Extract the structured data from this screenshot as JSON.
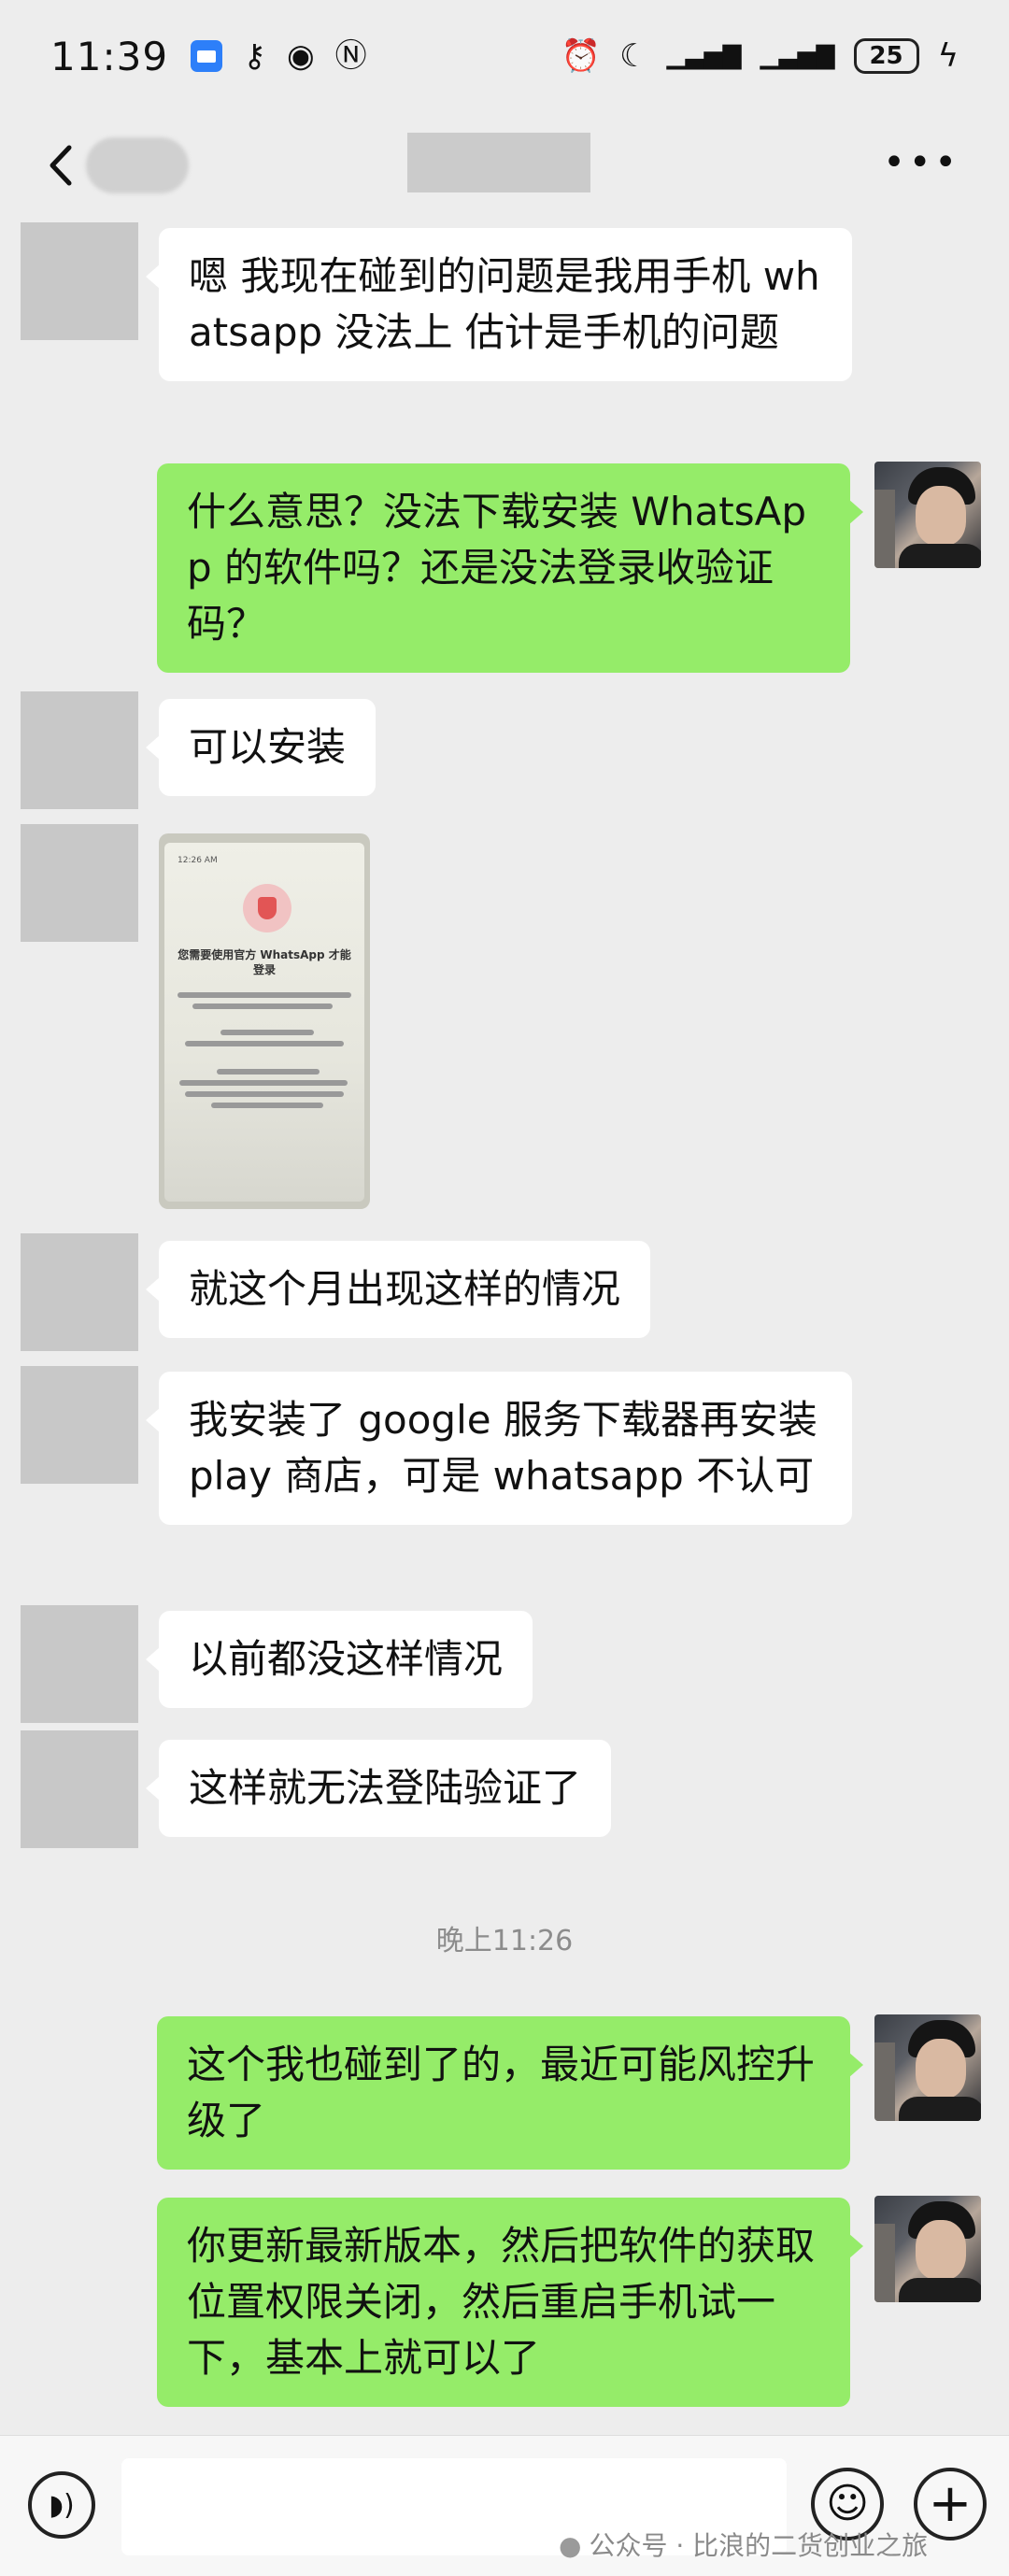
{
  "status_bar": {
    "time": "11:39",
    "battery": "25",
    "icons_left": [
      "message-icon",
      "key-icon",
      "eye-icon",
      "nfc-icon"
    ],
    "icons_right": [
      "alarm-icon",
      "moon-icon",
      "signal-icon",
      "signal-icon",
      "battery-icon",
      "charging-icon"
    ]
  },
  "header": {
    "back_icon": "chevron-left-icon",
    "more_icon": "more-dots-icon"
  },
  "messages": [
    {
      "side": "left",
      "type": "text",
      "text": "嗯 我现在碰到的问题是我用手机 whatsapp 没法上 估计是手机的问题"
    },
    {
      "side": "right",
      "type": "text",
      "text": "什么意思？没法下载安装 WhatsApp 的软件吗？还是没法登录收验证码？"
    },
    {
      "side": "left",
      "type": "text",
      "text": "可以安装"
    },
    {
      "side": "left",
      "type": "image",
      "caption": "您需要使用官方 WhatsApp 才能登录",
      "status_time": "12:26 AM"
    },
    {
      "side": "left",
      "type": "text",
      "text": "就这个月出现这样的情况"
    },
    {
      "side": "left",
      "type": "text",
      "text": "我安装了 google 服务下载器再安装 play 商店，可是 whatsapp 不认可"
    },
    {
      "side": "left",
      "type": "text",
      "text": "以前都没这样情况"
    },
    {
      "side": "left",
      "type": "text",
      "text": "这样就无法登陆验证了"
    },
    {
      "side": "right",
      "type": "text",
      "text": "这个我也碰到了的，最近可能风控升级了"
    },
    {
      "side": "right",
      "type": "text",
      "text": "你更新最新版本，然后把软件的获取位置权限关闭，然后重启手机试一下，基本上就可以了"
    }
  ],
  "timestamp": "晚上11:26",
  "input": {
    "voice_icon": "voice-icon",
    "emoji_icon": "emoji-icon",
    "plus_icon": "plus-icon",
    "value": ""
  },
  "watermark": "公众号 · 比浪的二货创业之旅",
  "colors": {
    "background": "#ededed",
    "bubble_left": "#ffffff",
    "bubble_right": "#95ec69"
  }
}
